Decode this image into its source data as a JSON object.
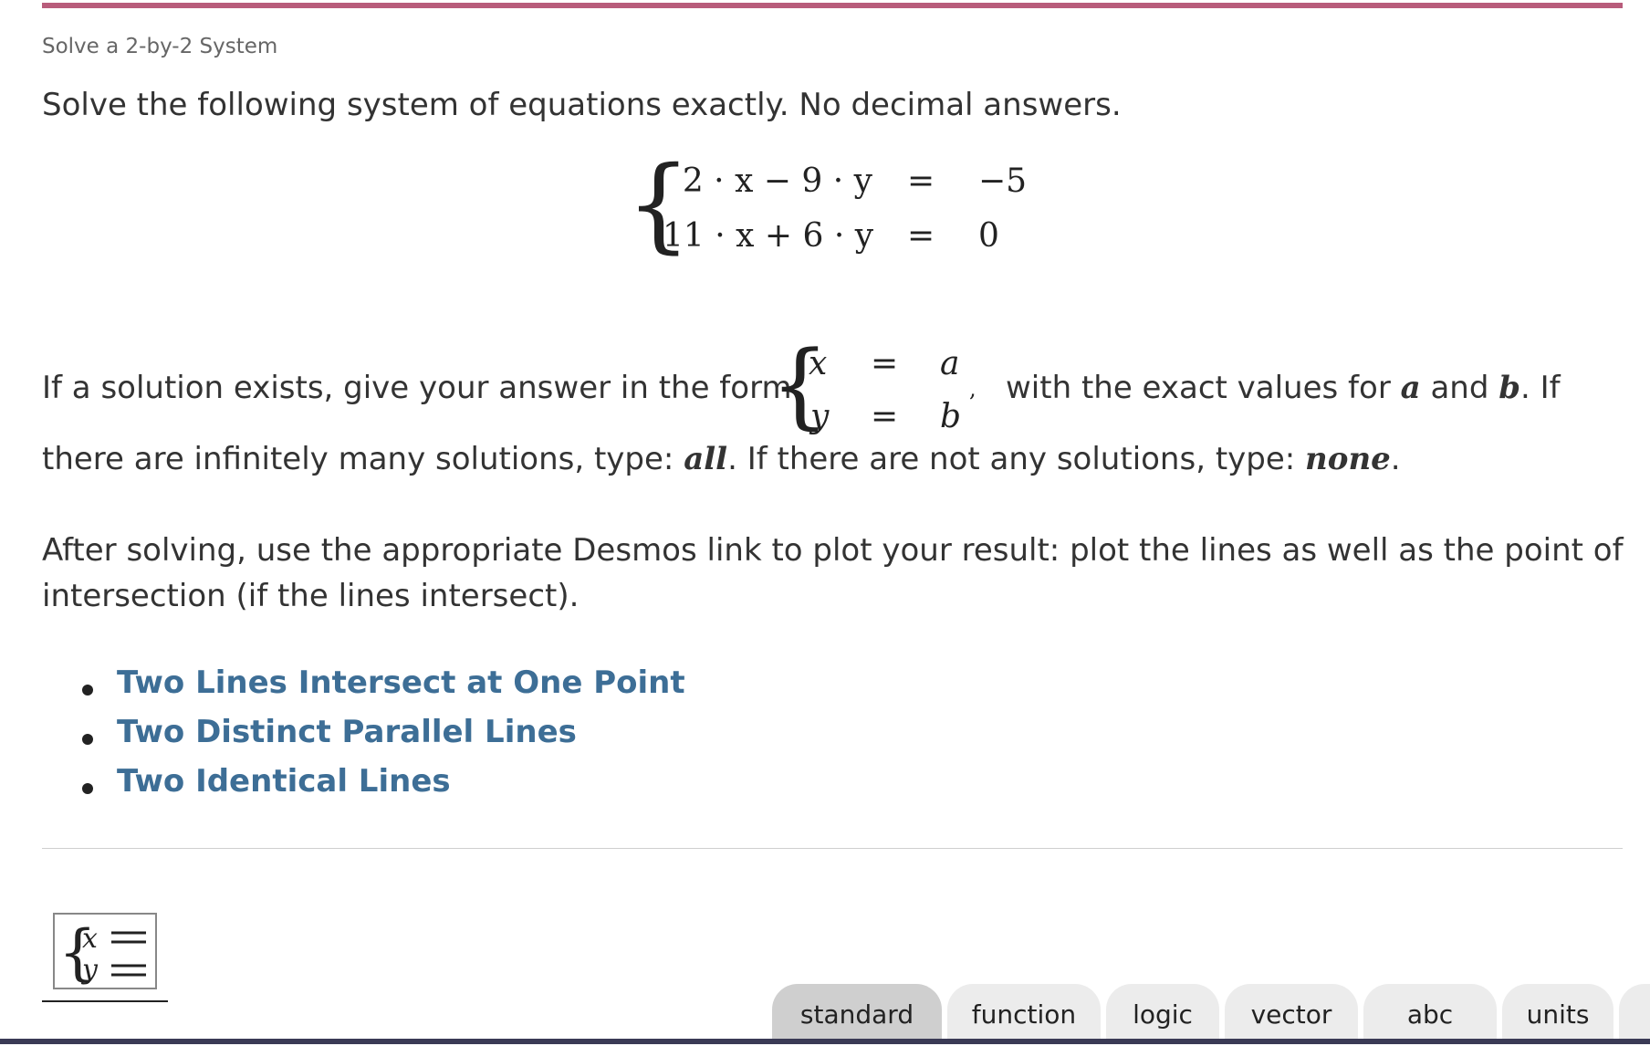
{
  "breadcrumb": "Solve a 2-by-2 System",
  "intro": "Solve the following system of equations exactly. No decimal answers.",
  "system": {
    "row1": {
      "lhs": "2 · x − 9 · y",
      "eq": "=",
      "rhs": "−5"
    },
    "row2": {
      "lhs": "11 · x + 6 · y",
      "eq": "=",
      "rhs": "0"
    }
  },
  "form_paragraph": {
    "before": "If a solution exists, give your answer in the form",
    "answer_form": {
      "x": "x",
      "eq1": "=",
      "a": "a",
      "y": "y",
      "eq2": "=",
      "b": "b",
      "comma": ","
    },
    "after1": "with the exact values for",
    "var_a": "a",
    "and": "and",
    "var_b": "b",
    "after2": ". If",
    "line2_start": "there are infinitely many solutions, type:",
    "all": "all",
    "line2_mid": ". If there are not any solutions, type:",
    "none": "none",
    "line2_end": "."
  },
  "desmos_paragraph": {
    "line1": "After solving, use the appropriate Desmos link to plot your result: plot the lines as well as the point of",
    "line2": "intersection (if the lines intersect)."
  },
  "links": [
    "Two Lines Intersect at One Point",
    "Two Distinct Parallel Lines",
    "Two Identical Lines"
  ],
  "system_button": {
    "x": "x",
    "y": "y"
  },
  "keyboard_tabs": [
    "standard",
    "function",
    "logic",
    "vector",
    "abc",
    "units"
  ],
  "colors": {
    "accent": "#b85c7b",
    "link": "#3d6e96",
    "bottom_bar": "#3a3a55"
  }
}
